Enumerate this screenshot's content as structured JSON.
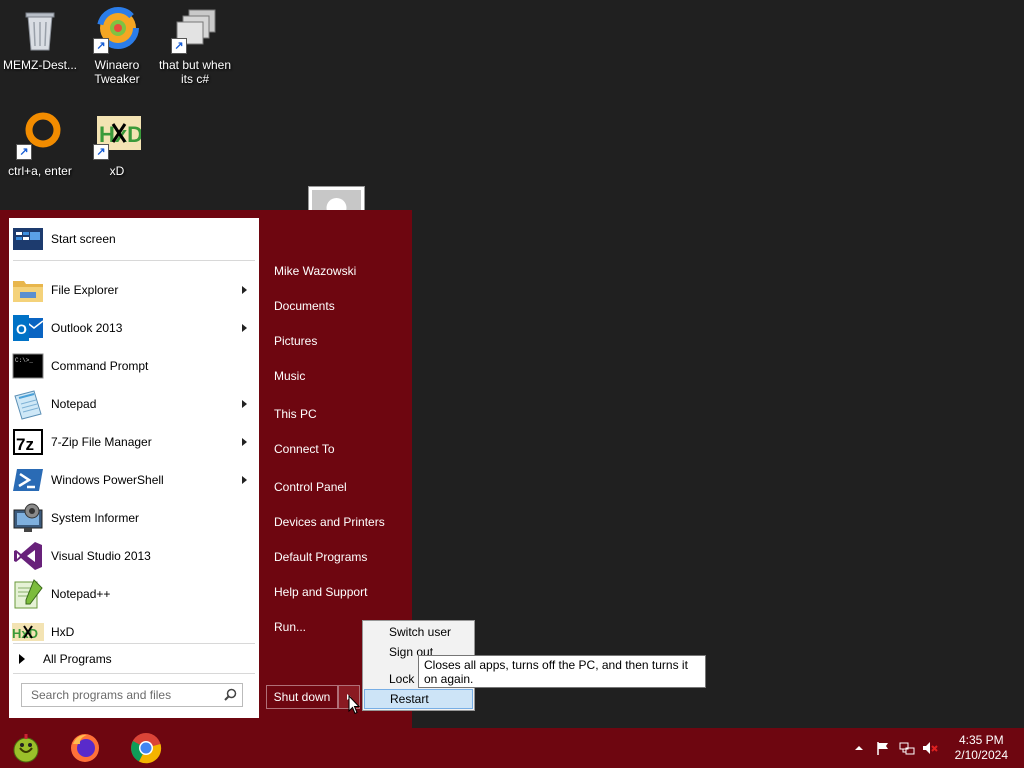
{
  "desktop": {
    "icons": [
      {
        "label": "MEMZ-Dest..."
      },
      {
        "label": "Winaero Tweaker"
      },
      {
        "label": "that but when its c#"
      },
      {
        "label": "ctrl+a, enter"
      },
      {
        "label": "xD"
      }
    ],
    "hxd_logo_text": "HxD"
  },
  "start_menu": {
    "programs": [
      {
        "label": "Start screen",
        "icon": "start-screen-icon",
        "submenu": false
      },
      {
        "label": "File Explorer",
        "icon": "file-explorer-icon",
        "submenu": true
      },
      {
        "label": "Outlook 2013",
        "icon": "outlook-icon",
        "submenu": true
      },
      {
        "label": "Command Prompt",
        "icon": "command-prompt-icon",
        "submenu": false
      },
      {
        "label": "Notepad",
        "icon": "notepad-icon",
        "submenu": true
      },
      {
        "label": "7-Zip File Manager",
        "icon": "7zip-icon",
        "submenu": true
      },
      {
        "label": "Windows PowerShell",
        "icon": "powershell-icon",
        "submenu": true
      },
      {
        "label": "System Informer",
        "icon": "system-informer-icon",
        "submenu": false
      },
      {
        "label": "Visual Studio 2013",
        "icon": "visual-studio-icon",
        "submenu": false
      },
      {
        "label": "Notepad++",
        "icon": "notepad-plus-plus-icon",
        "submenu": false
      },
      {
        "label": "HxD",
        "icon": "hxd-icon",
        "submenu": false
      }
    ],
    "icon_glyphs": {
      "outlook": "O",
      "cmd": "C:\\>_",
      "sevenzip": "7z"
    },
    "all_programs": "All Programs",
    "search_placeholder": "Search programs and files",
    "right_items": [
      "Mike Wazowski",
      "Documents",
      "Pictures",
      "Music",
      "This PC",
      "Connect To",
      "Control Panel",
      "Devices and Printers",
      "Default Programs",
      "Help and Support",
      "Run..."
    ],
    "shutdown_label": "Shut down",
    "power_menu": [
      {
        "label": "Switch user",
        "highlighted": false
      },
      {
        "label": "Sign out",
        "highlighted": false
      },
      {
        "label": "Lock",
        "highlighted": false
      },
      {
        "label": "Restart",
        "highlighted": true
      }
    ],
    "tooltip": "Closes all apps, turns off the PC, and then turns it on again."
  },
  "taskbar": {
    "pinned": [
      "memz-icon",
      "firefox-icon",
      "chrome-icon"
    ],
    "tray": [
      "show-hidden-icons-chevron",
      "action-center-flag-icon",
      "network-icon",
      "volume-muted-icon"
    ],
    "time": "4:35 PM",
    "date": "2/10/2024"
  },
  "theme": {
    "accent": "#6e0610",
    "desktop_bg": "#202020",
    "highlight": "#cde4f7"
  }
}
